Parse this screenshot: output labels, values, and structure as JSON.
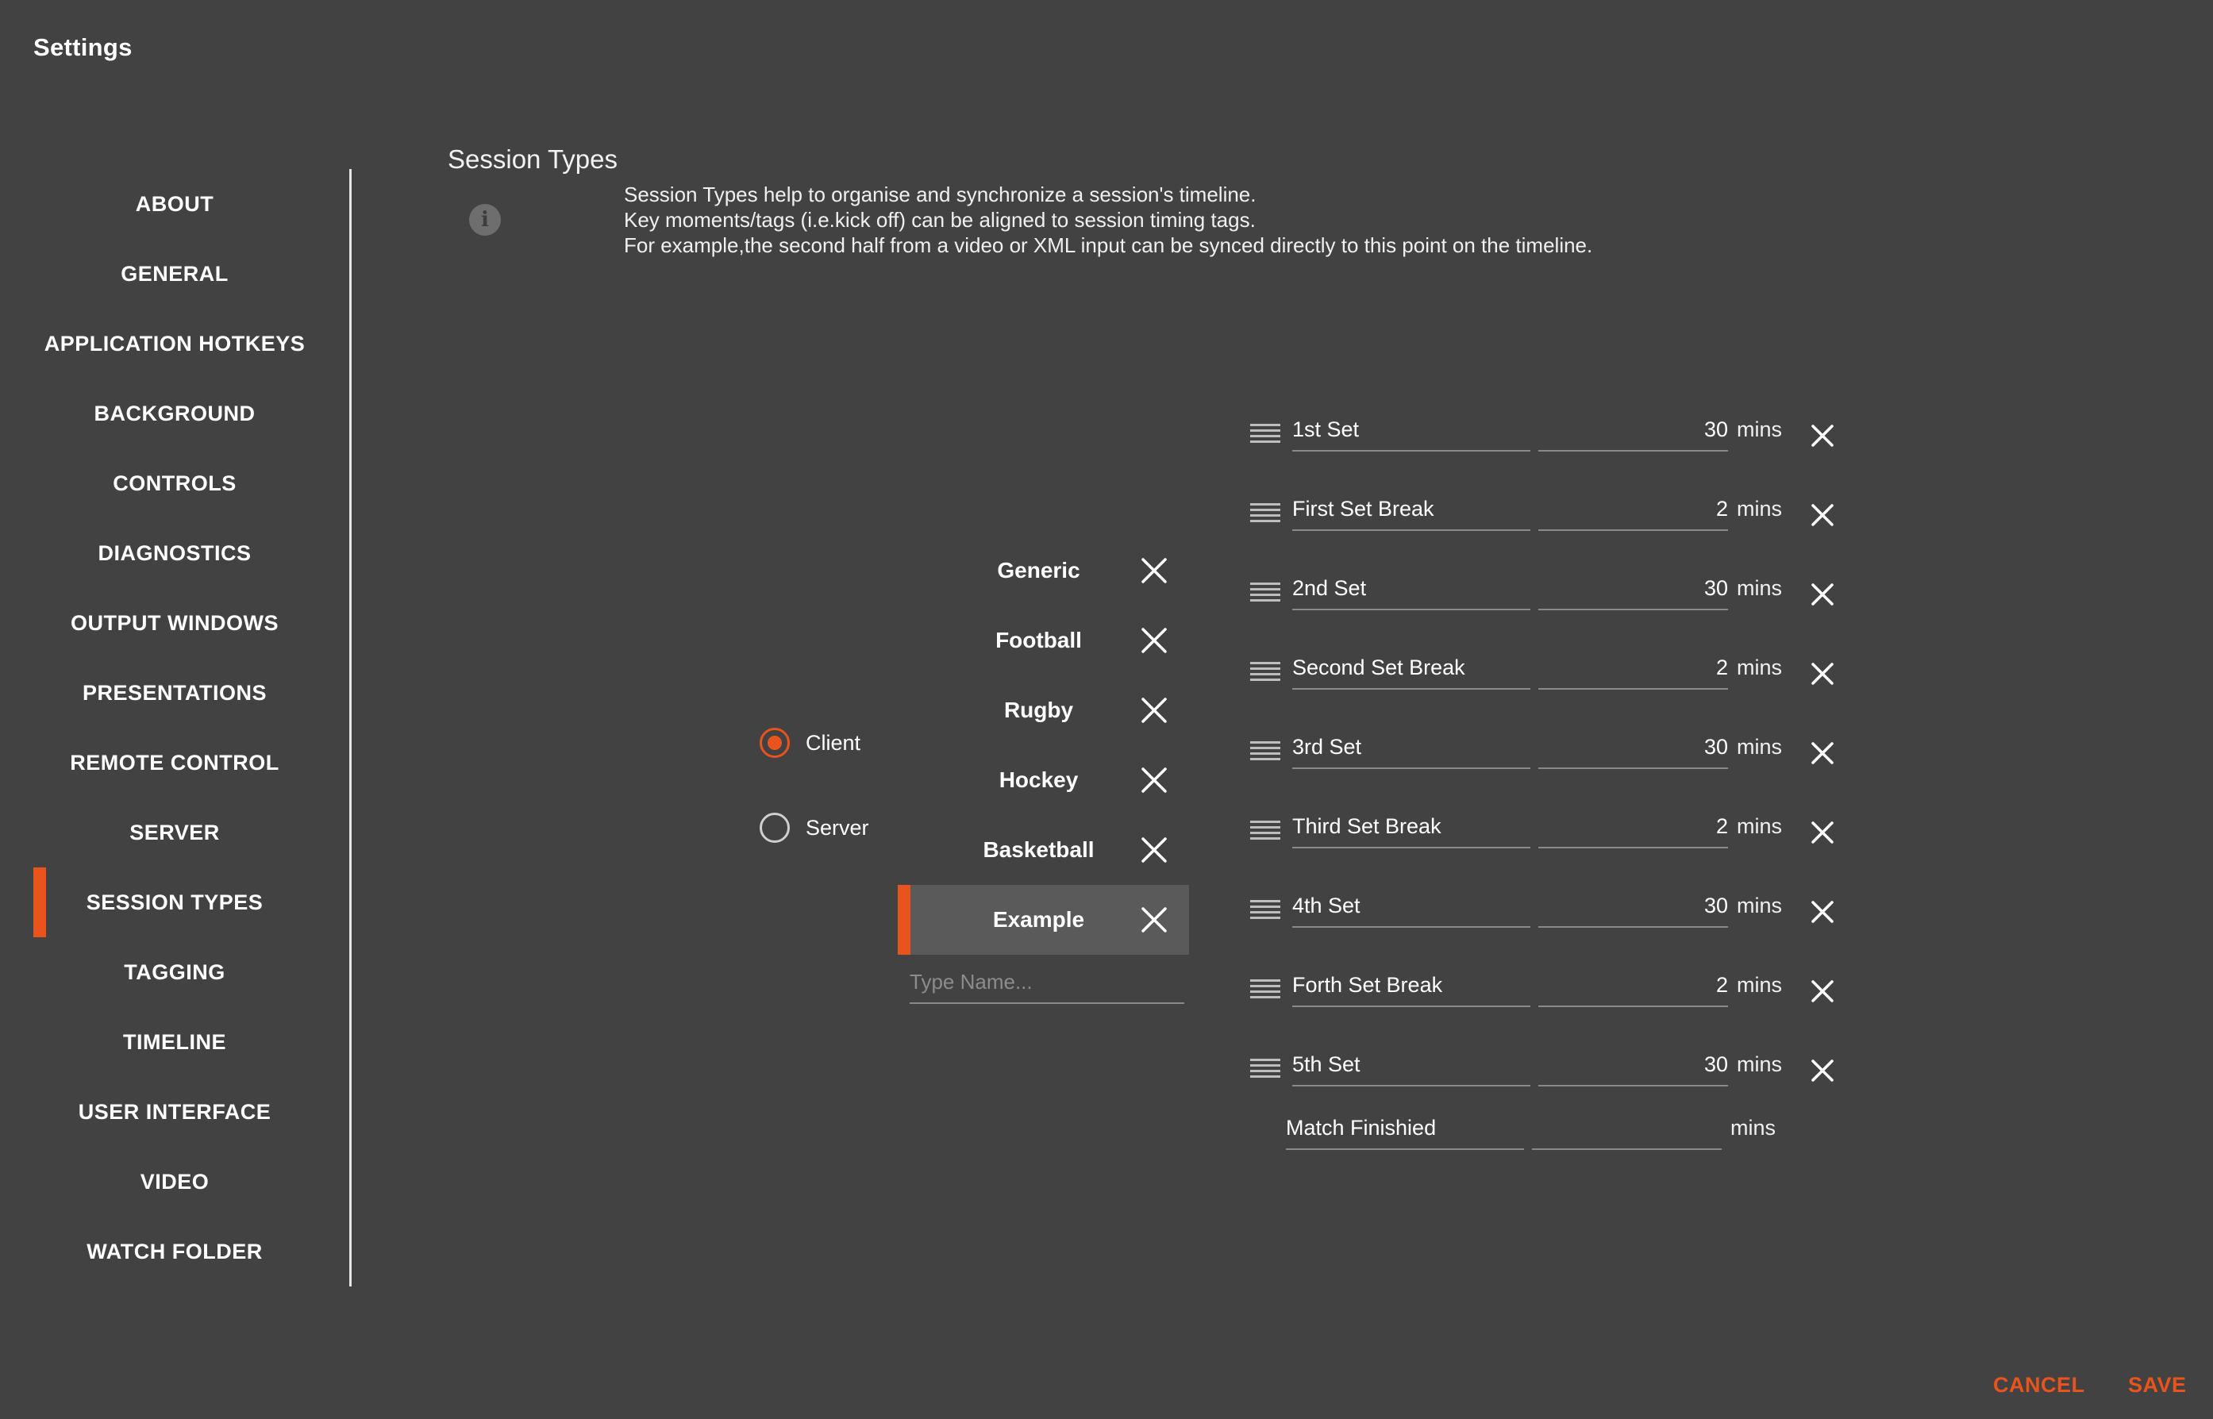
{
  "window": {
    "title": "Settings"
  },
  "sidebar": {
    "items": [
      {
        "label": "ABOUT"
      },
      {
        "label": "GENERAL"
      },
      {
        "label": "APPLICATION HOTKEYS"
      },
      {
        "label": "BACKGROUND"
      },
      {
        "label": "CONTROLS"
      },
      {
        "label": "DIAGNOSTICS"
      },
      {
        "label": "OUTPUT WINDOWS"
      },
      {
        "label": "PRESENTATIONS"
      },
      {
        "label": "REMOTE CONTROL"
      },
      {
        "label": "SERVER"
      },
      {
        "label": "SESSION TYPES"
      },
      {
        "label": "TAGGING"
      },
      {
        "label": "TIMELINE"
      },
      {
        "label": "USER INTERFACE"
      },
      {
        "label": "VIDEO"
      },
      {
        "label": "WATCH FOLDER"
      }
    ],
    "active": "SESSION TYPES"
  },
  "section": {
    "title": "Session Types",
    "info_icon": "info-icon",
    "description": [
      "Session Types help to organise and synchronize a session's timeline.",
      "Key moments/tags (i.e.kick off) can be aligned to session timing tags.",
      "For example,the second half from a video or XML input can be synced directly to this point on the timeline."
    ]
  },
  "mode": {
    "options": [
      {
        "label": "Client",
        "checked": true
      },
      {
        "label": "Server",
        "checked": false
      }
    ]
  },
  "types": {
    "items": [
      {
        "name": "Generic"
      },
      {
        "name": "Football"
      },
      {
        "name": "Rugby"
      },
      {
        "name": "Hockey"
      },
      {
        "name": "Basketball"
      },
      {
        "name": "Example"
      }
    ],
    "selected": "Example",
    "new_placeholder": "Type Name..."
  },
  "timings": {
    "items": [
      {
        "name": "1st Set",
        "duration": "30",
        "unit": "mins"
      },
      {
        "name": "First Set Break",
        "duration": "2",
        "unit": "mins"
      },
      {
        "name": "2nd Set",
        "duration": "30",
        "unit": "mins"
      },
      {
        "name": "Second Set Break",
        "duration": "2",
        "unit": "mins"
      },
      {
        "name": "3rd Set",
        "duration": "30",
        "unit": "mins"
      },
      {
        "name": "Third Set Break",
        "duration": "2",
        "unit": "mins"
      },
      {
        "name": "4th Set",
        "duration": "30",
        "unit": "mins"
      },
      {
        "name": "Forth Set Break",
        "duration": "2",
        "unit": "mins"
      },
      {
        "name": "5th Set",
        "duration": "30",
        "unit": "mins"
      }
    ],
    "final": {
      "name": "Match Finishied",
      "duration": "",
      "unit": "mins"
    }
  },
  "footer": {
    "cancel_label": "CANCEL",
    "save_label": "SAVE"
  },
  "colors": {
    "background": "#424242",
    "accent": "#e8541c",
    "selected_row": "#5a5a5a"
  }
}
